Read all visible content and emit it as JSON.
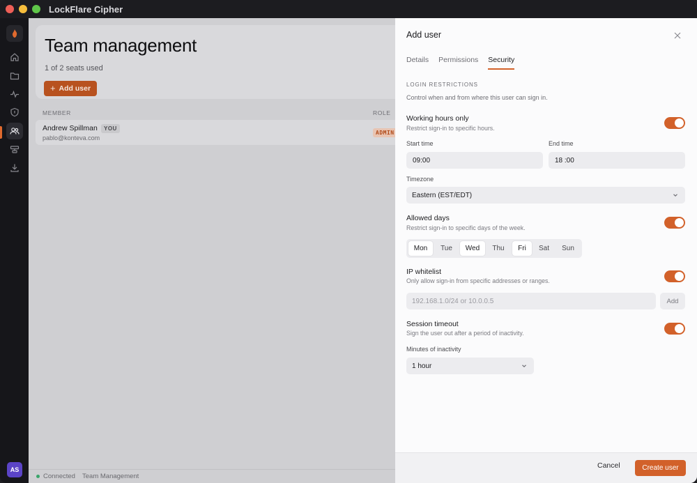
{
  "app": {
    "title": "LockFlare Cipher"
  },
  "sidebar": {
    "avatar_initials": "AS",
    "items": [
      {
        "icon": "home-icon"
      },
      {
        "icon": "folder-icon"
      },
      {
        "icon": "activity-icon"
      },
      {
        "icon": "shield-icon"
      },
      {
        "icon": "users-icon",
        "active": true
      },
      {
        "icon": "servers-icon"
      },
      {
        "icon": "download-icon"
      }
    ]
  },
  "main": {
    "title": "Team management",
    "seats": "1 of 2 seats used",
    "add_user_label": "Add user",
    "table": {
      "headers": {
        "member": "MEMBER",
        "role": "ROLE"
      },
      "rows": [
        {
          "name": "Andrew Spillman",
          "badge": "YOU",
          "email": "pablo@konteva.com",
          "role": "ADMIN"
        }
      ]
    }
  },
  "statusbar": {
    "connection": "Connected",
    "page": "Team Management"
  },
  "drawer": {
    "title": "Add user",
    "tabs": [
      {
        "label": "Details"
      },
      {
        "label": "Permissions"
      },
      {
        "label": "Security",
        "active": true
      }
    ],
    "section_heading": "LOGIN RESTRICTIONS",
    "section_desc": "Control when and from where this user can sign in.",
    "working_hours": {
      "title": "Working hours only",
      "desc": "Restrict sign-in to specific hours.",
      "enabled": true,
      "start_label": "Start time",
      "start_value": "09:00",
      "end_label": "End time",
      "end_value": "18 :00",
      "timezone_label": "Timezone",
      "timezone_value": "Eastern (EST/EDT)"
    },
    "allowed_days": {
      "title": "Allowed days",
      "desc": "Restrict sign-in to specific days of the week.",
      "enabled": true,
      "days": [
        {
          "label": "Mon",
          "on": true
        },
        {
          "label": "Tue",
          "on": false
        },
        {
          "label": "Wed",
          "on": true
        },
        {
          "label": "Thu",
          "on": false
        },
        {
          "label": "Fri",
          "on": true
        },
        {
          "label": "Sat",
          "on": false
        },
        {
          "label": "Sun",
          "on": false
        }
      ]
    },
    "ip_whitelist": {
      "title": "IP whitelist",
      "desc": "Only allow sign-in from specific addresses or ranges.",
      "enabled": true,
      "placeholder": "192.168.1.0/24 or 10.0.0.5",
      "add_label": "Add"
    },
    "session_timeout": {
      "title": "Session timeout",
      "desc": "Sign the user out after a period of inactivity.",
      "enabled": true,
      "minutes_label": "Minutes of inactivity",
      "minutes_value": "1 hour"
    },
    "footer": {
      "cancel_label": "Cancel",
      "create_label": "Create user"
    }
  },
  "colors": {
    "accent": "#d2612a",
    "sidebar_bg": "#16161a",
    "avatar": "#5b44c7"
  }
}
